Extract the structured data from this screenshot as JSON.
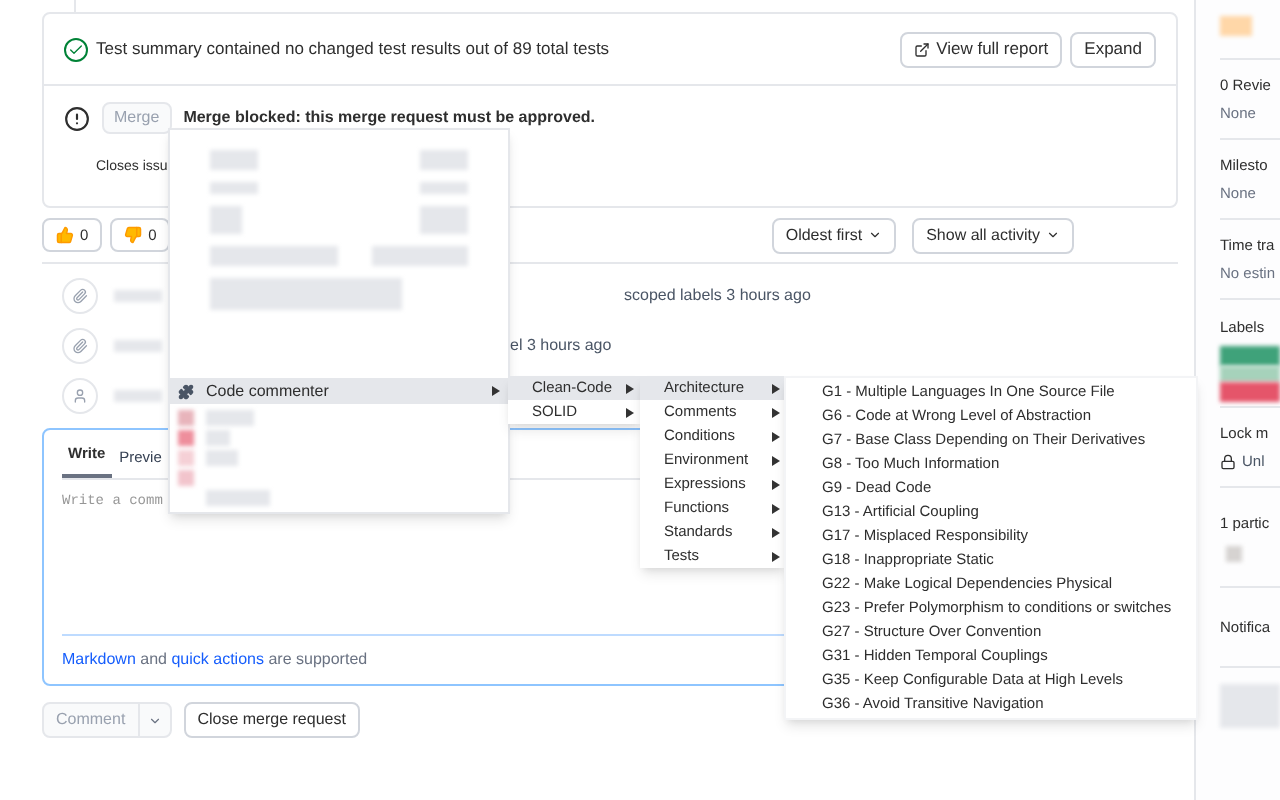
{
  "report": {
    "summary": "Test summary contained no changed test results out of 89 total tests",
    "buttons": [
      "View full report",
      "Expand"
    ]
  },
  "merge": {
    "button": "Merge",
    "disabled": true,
    "message": "Merge blocked: this merge request must be approved.",
    "closes": "Closes issu"
  },
  "reactions": [
    {
      "kind": "thumbs-up",
      "count": "0"
    },
    {
      "kind": "thumbs-down",
      "count": "0"
    }
  ],
  "sort": [
    "Oldest first",
    "Show all activity"
  ],
  "timeline": [
    {
      "kind": "label",
      "text": "scoped labels 3 hours ago"
    },
    {
      "kind": "label",
      "text": "el 3 hours ago"
    },
    {
      "kind": "user"
    }
  ],
  "editor": {
    "tabs": [
      {
        "label": "Write",
        "selected": true
      },
      {
        "label": "Previe",
        "selected": false
      }
    ],
    "placeholder": "Write a comm",
    "help": [
      {
        "text": "Markdown",
        "link": true
      },
      {
        "text": "and",
        "link": false
      },
      {
        "text": "quick actions",
        "link": true
      },
      {
        "text": "are supported",
        "link": false
      }
    ]
  },
  "actions": {
    "comment": "Comment",
    "close": "Close merge request"
  },
  "context_menu": {
    "items": [
      {
        "label": "Code commenter",
        "selected": true
      }
    ]
  },
  "submenu_1": [
    {
      "label": "Clean-Code",
      "selected": true
    },
    {
      "label": "SOLID",
      "selected": false
    }
  ],
  "submenu_2": [
    {
      "label": "Architecture",
      "selected": true
    },
    {
      "label": "Comments",
      "selected": false
    },
    {
      "label": "Conditions",
      "selected": false
    },
    {
      "label": "Environment",
      "selected": false
    },
    {
      "label": "Expressions",
      "selected": false
    },
    {
      "label": "Functions",
      "selected": false
    },
    {
      "label": "Standards",
      "selected": false
    },
    {
      "label": "Tests",
      "selected": false
    }
  ],
  "submenu_3": [
    "G1 - Multiple Languages In One Source File",
    "G6 - Code at Wrong Level of Abstraction",
    "G7 - Base Class Depending on Their Derivatives",
    "G8 - Too Much Information",
    "G9 - Dead Code",
    "G13 - Artificial Coupling",
    "G17 - Misplaced Responsibility",
    "G18 - Inappropriate Static",
    "G22 - Make Logical Dependencies Physical",
    "G23 - Prefer Polymorphism to conditions or switches",
    "G27 - Structure Over Convention",
    "G31 - Hidden Temporal Couplings",
    "G35 - Keep Configurable Data at High Levels",
    "G36 - Avoid Transitive Navigation"
  ],
  "sidebar": [
    {
      "kind": "avatar"
    },
    {
      "kind": "text",
      "title": "0 Revie",
      "value": "None"
    },
    {
      "kind": "text",
      "title": "Milesto",
      "value": "None"
    },
    {
      "kind": "text",
      "title": "Time tra",
      "value": "No estin"
    },
    {
      "kind": "labels",
      "title": "Labels"
    },
    {
      "kind": "lock",
      "title": "Lock m",
      "value": "Unl"
    },
    {
      "kind": "participants",
      "title": "1 partic"
    },
    {
      "kind": "text",
      "title": "Notifica"
    },
    {
      "kind": "blurred"
    }
  ]
}
